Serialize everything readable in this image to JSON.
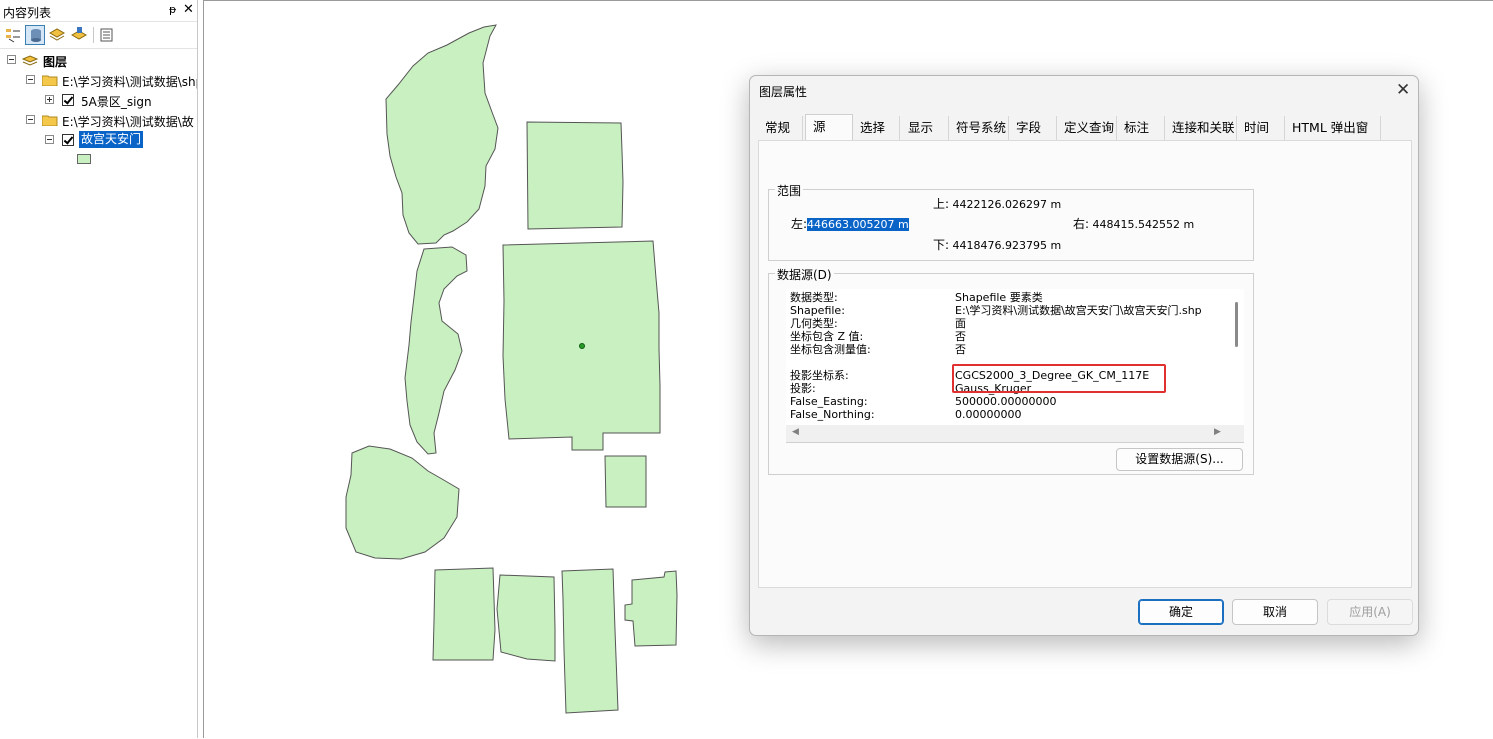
{
  "toc": {
    "title": "内容列表",
    "pin_glyph": "ᵽ",
    "close_glyph": "✕",
    "toolbar_icons": [
      "list-by-drawing-order-icon",
      "list-by-source-icon",
      "list-by-visibility-icon",
      "list-by-selection-icon",
      "options-icon"
    ],
    "root_label": "图层",
    "groups": [
      {
        "path": "E:\\学习资料\\测试数据\\shp",
        "layers": [
          {
            "name": "5A景区_sign",
            "checked": true,
            "expanded": false
          }
        ]
      },
      {
        "path": "E:\\学习资料\\测试数据\\故",
        "layers": [
          {
            "name": "故宫天安门",
            "checked": true,
            "expanded": true,
            "selected": true
          }
        ]
      }
    ],
    "symbol_color": "#c8f0c0"
  },
  "map": {
    "fill_color": "#c8f0c0",
    "stroke_color": "#555555"
  },
  "dialog": {
    "title": "图层属性",
    "close_glyph": "✕",
    "tabs": [
      {
        "label": "常规",
        "active": false
      },
      {
        "label": "源",
        "active": true
      },
      {
        "label": "选择",
        "active": false
      },
      {
        "label": "显示",
        "active": false
      },
      {
        "label": "符号系统",
        "active": false
      },
      {
        "label": "字段",
        "active": false
      },
      {
        "label": "定义查询",
        "active": false
      },
      {
        "label": "标注",
        "active": false
      },
      {
        "label": "连接和关联",
        "active": false
      },
      {
        "label": "时间",
        "active": false
      },
      {
        "label": "HTML 弹出窗口",
        "active": false
      }
    ],
    "extent": {
      "legend": "范围",
      "top_label": "上:",
      "top_value": "4422126.026297 m",
      "left_label": "左:",
      "left_value": "446663.005207 m",
      "right_label": "右:",
      "right_value": "448415.542552 m",
      "bottom_label": "下:",
      "bottom_value": "4418476.923795 m"
    },
    "datasource": {
      "legend": "数据源(D)",
      "rows": [
        {
          "key": "数据类型:",
          "value": "Shapefile 要素类"
        },
        {
          "key": "Shapefile:",
          "value": "E:\\学习资料\\测试数据\\故宫天安门\\故宫天安门.shp"
        },
        {
          "key": "几何类型:",
          "value": "面"
        },
        {
          "key": "坐标包含 Z 值:",
          "value": "否"
        },
        {
          "key": "坐标包含测量值:",
          "value": "否"
        },
        {
          "key": "投影坐标系:",
          "value": "CGCS2000_3_Degree_GK_CM_117E"
        },
        {
          "key": "投影:",
          "value": "Gauss_Kruger"
        },
        {
          "key": "False_Easting:",
          "value": "500000.00000000"
        },
        {
          "key": "False_Northing:",
          "value": "0.00000000"
        }
      ],
      "scroll_left_glyph": "◀",
      "scroll_right_glyph": "▶",
      "set_source_button": "设置数据源(S)..."
    },
    "buttons": {
      "ok": "确定",
      "cancel": "取消",
      "apply": "应用(A)"
    }
  }
}
